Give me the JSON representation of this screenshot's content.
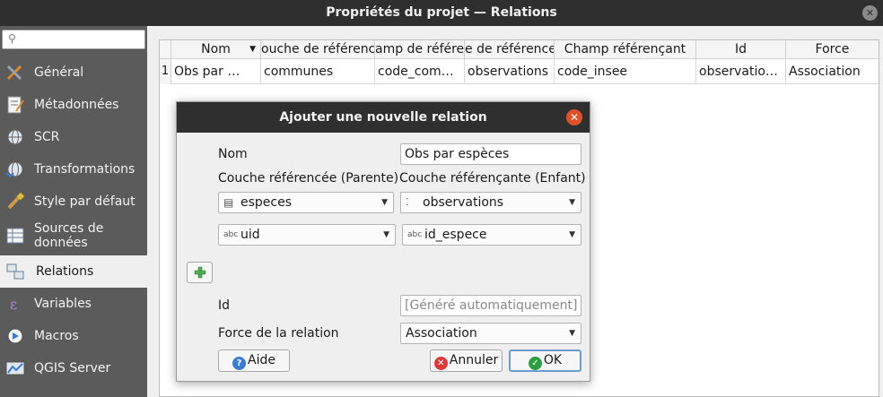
{
  "window": {
    "title": "Propriétés du projet — Relations"
  },
  "sidebar": {
    "search_placeholder": "",
    "items": [
      {
        "label": "Général",
        "icon": "tools-icon"
      },
      {
        "label": "Métadonnées",
        "icon": "notepad-icon"
      },
      {
        "label": "SCR",
        "icon": "globe-icon"
      },
      {
        "label": "Transformations",
        "icon": "globe-transform-icon"
      },
      {
        "label": "Style par défaut",
        "icon": "paintbrush-icon"
      },
      {
        "label": "Sources de données",
        "icon": "table-icon"
      },
      {
        "label": "Relations",
        "icon": "relations-icon"
      },
      {
        "label": "Variables",
        "icon": "expression-icon"
      },
      {
        "label": "Macros",
        "icon": "macro-icon"
      },
      {
        "label": "QGIS Server",
        "icon": "server-icon"
      }
    ]
  },
  "table": {
    "columns": [
      "Nom",
      "ouche de référenc",
      "amp de référe",
      "e de référence",
      "Champ référençant",
      "Id",
      "Force"
    ],
    "rows": [
      {
        "num": "1",
        "cells": [
          "Obs par …",
          "communes",
          "code_com…",
          "observations",
          "code_insee",
          "observatio…",
          "Association"
        ]
      }
    ]
  },
  "dialog": {
    "title": "Ajouter une nouvelle relation",
    "name_label": "Nom",
    "name_value": "Obs par espèces",
    "parent_label": "Couche référencée (Parente)",
    "child_label": "Couche référençante (Enfant)",
    "parent_layer": "especes",
    "child_layer": "observations",
    "parent_field_icon": "abc",
    "parent_field": "uid",
    "child_field_icon": "abc",
    "child_field": "id_espece",
    "id_label": "Id",
    "id_placeholder": "[Généré automatiquement]",
    "strength_label": "Force de la relation",
    "strength_value": "Association",
    "help_button": "Aide",
    "cancel_button": "Annuler",
    "ok_button": "OK"
  },
  "colors": {
    "dialog_close": "#e0512a",
    "ok_border": "#6a9ccf",
    "sidebar_bg": "#5b5b5b",
    "titlebar_bg": "#2f2f2f"
  }
}
